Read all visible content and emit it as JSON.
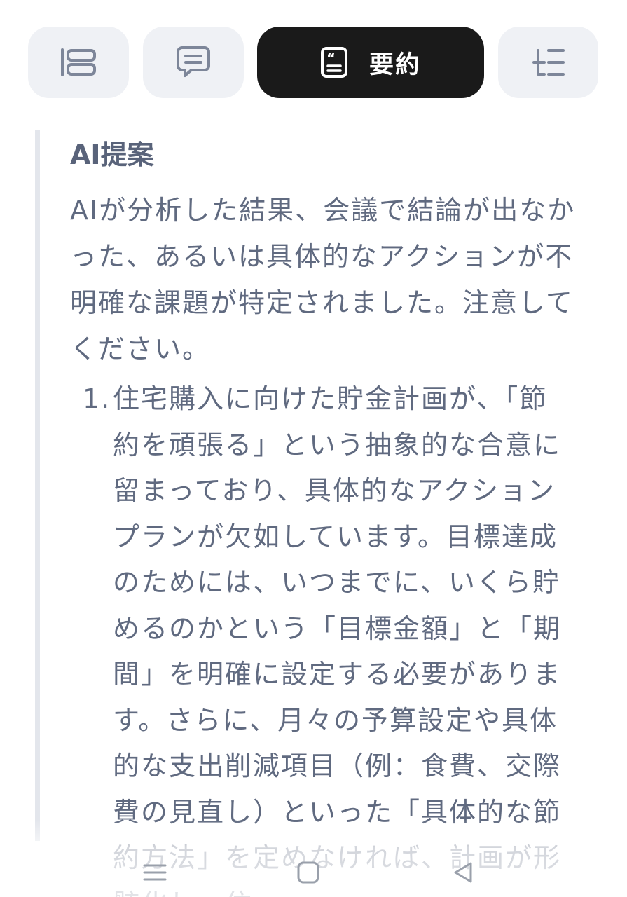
{
  "tabs": [
    {
      "icon": "list-layout-icon",
      "label": ""
    },
    {
      "icon": "chat-bubble-icon",
      "label": ""
    },
    {
      "icon": "summary-quote-icon",
      "label": "要約",
      "active": true
    },
    {
      "icon": "outline-icon",
      "label": ""
    }
  ],
  "summary": {
    "heading": "AI提案",
    "intro": "AIが分析した結果、会議で結論が出なかった、あるいは具体的なアクションが不明確な課題が特定されました。注意してください。",
    "items": [
      {
        "number": "1.",
        "text": "住宅購入に向けた貯金計画が、「節約を頑張る」という抽象的な合意に留まっており、具体的なアクションプランが欠如しています。目標達成のためには、いつまでに、いくら貯めるのかという「目標金額」と「期間」を明確に設定する必要があります。さらに、月々の予算設定や具体的な支出削減項目（例：食費、交際費の見直し）といった「具体的な節約方法」を定めなければ、計画が形骸化し、住"
      }
    ]
  },
  "navbar": {
    "buttons": [
      "menu-icon",
      "home-icon",
      "back-icon"
    ]
  },
  "colors": {
    "active_tab_bg": "#1a1a1a",
    "tab_bg": "#eff1f5",
    "text": "#606a80",
    "accent_bar": "#e3e6ec"
  }
}
